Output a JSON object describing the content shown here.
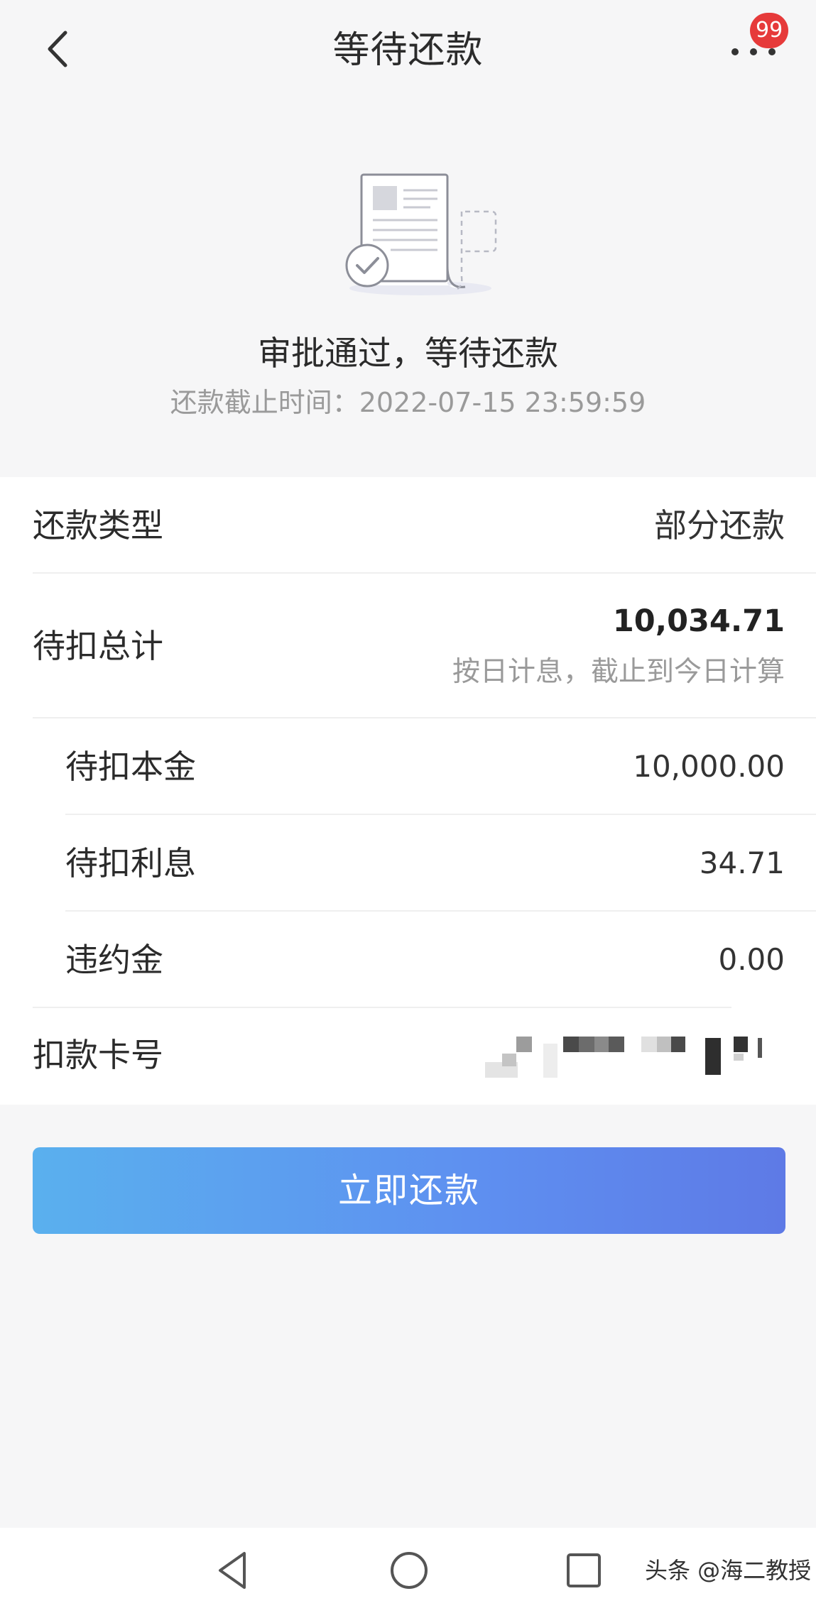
{
  "header": {
    "title": "等待还款",
    "badge_count": "99",
    "back_icon": "chevron-left-icon",
    "more_icon": "more-dots-icon"
  },
  "status": {
    "illustration": "document-approved-icon",
    "title": "审批通过，等待还款",
    "deadline": "还款截止时间：2022-07-15 23:59:59"
  },
  "details": {
    "repay_type": {
      "label": "还款类型",
      "value": "部分还款"
    },
    "total": {
      "label": "待扣总计",
      "value": "10,034.71",
      "note": "按日计息，截止到今日计算"
    },
    "principal": {
      "label": "待扣本金",
      "value": "10,000.00"
    },
    "interest": {
      "label": "待扣利息",
      "value": "34.71"
    },
    "penalty": {
      "label": "违约金",
      "value": "0.00"
    },
    "card": {
      "label": "扣款卡号"
    }
  },
  "actions": {
    "pay_now": "立即还款"
  },
  "system_nav": {
    "back_icon": "triangle-back-icon",
    "home_icon": "circle-home-icon",
    "recent_icon": "square-recent-icon"
  },
  "watermark": "头条 @海二教授",
  "colors": {
    "badge": "#e63a3a",
    "button_start": "#5ab0ee",
    "button_end": "#5e7ae6",
    "muted_text": "#9a9a9a"
  }
}
